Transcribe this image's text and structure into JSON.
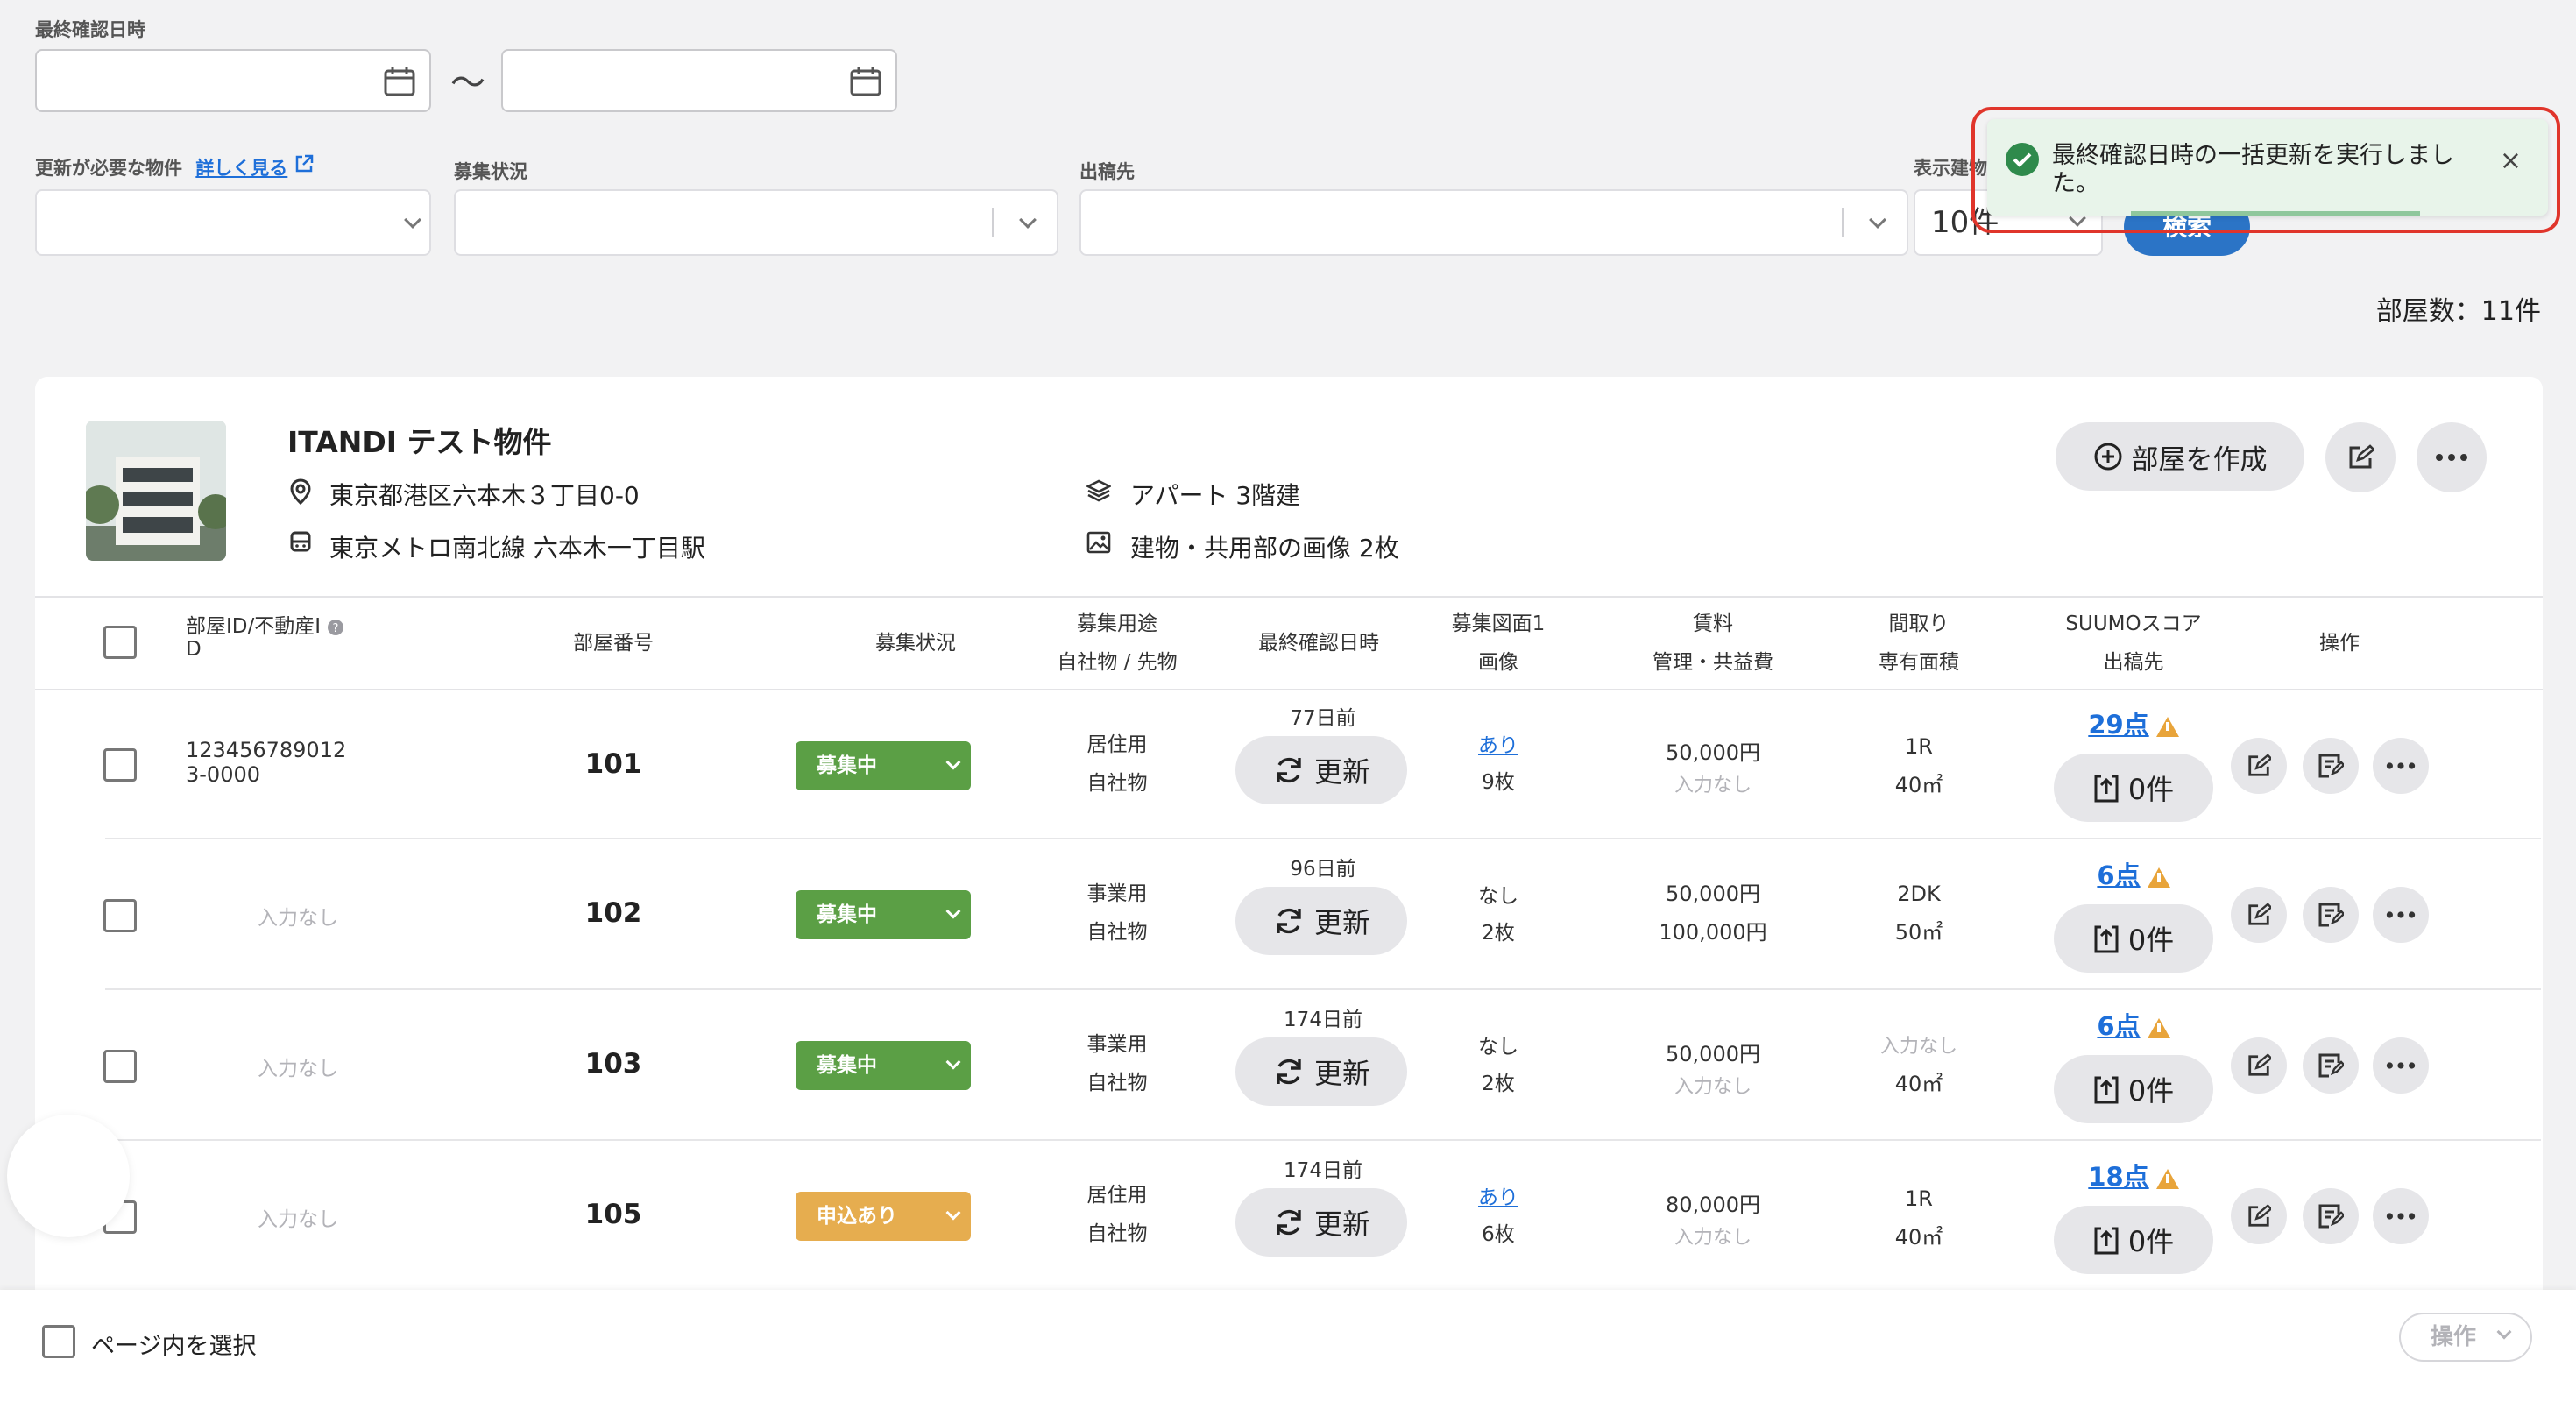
{
  "filters": {
    "last_confirmed_label": "最終確認日時",
    "range_sep": "〜",
    "needs_update_label": "更新が必要な物件",
    "details_link": "詳しく見る",
    "recruit_label": "募集状況",
    "publish_label": "出稿先",
    "display_label": "表示建物",
    "display_value": "10件",
    "search_button": "検索"
  },
  "room_count": "部屋数：11件",
  "toast": {
    "message": "最終確認日時の一括更新を実行しました。",
    "close": "×",
    "accent": "#2f8a4c"
  },
  "property": {
    "name": "ITANDI テスト物件",
    "address": "東京都港区六本木３丁目0-0",
    "station": "東京メトロ南北線 六本木一丁目駅",
    "type": "アパート 3階建",
    "images": "建物・共用部の画像 2枚",
    "create_room_button": "部屋を作成"
  },
  "table": {
    "headers": {
      "room_id_1": "部屋ID/不動産I",
      "room_id_2": "D",
      "room_no": "部屋番号",
      "status": "募集状況",
      "use_1": "募集用途",
      "use_2": "自社物 / 先物",
      "last_confirmed": "最終確認日時",
      "plan_1": "募集図面1",
      "plan_2": "画像",
      "rent_1": "賃料",
      "rent_2": "管理・共益費",
      "layout_1": "間取り",
      "layout_2": "専有面積",
      "suumo_1": "SUUMOスコア",
      "suumo_2": "出稿先",
      "ops": "操作"
    },
    "update_label": "更新",
    "rows": [
      {
        "id_1": "123456789012",
        "id_2": "3-0000",
        "room_no": "101",
        "status": "募集中",
        "use": "居住用",
        "owner": "自社物",
        "days": "77日前",
        "plan": "あり",
        "plan_count": "9枚",
        "rent": "50,000円",
        "fee": "入力なし",
        "layout": "1R",
        "area": "40㎡",
        "score": "29点",
        "publish": "0件"
      },
      {
        "id_1": "入力なし",
        "id_2": "",
        "room_no": "102",
        "status": "募集中",
        "use": "事業用",
        "owner": "自社物",
        "days": "96日前",
        "plan": "なし",
        "plan_count": "2枚",
        "rent": "50,000円",
        "fee": "100,000円",
        "layout": "2DK",
        "area": "50㎡",
        "score": "6点",
        "publish": "0件"
      },
      {
        "id_1": "入力なし",
        "id_2": "",
        "room_no": "103",
        "status": "募集中",
        "use": "事業用",
        "owner": "自社物",
        "days": "174日前",
        "plan": "なし",
        "plan_count": "2枚",
        "rent": "50,000円",
        "fee": "入力なし",
        "layout": "入力なし",
        "area": "40㎡",
        "score": "6点",
        "publish": "0件"
      },
      {
        "id_1": "入力なし",
        "id_2": "",
        "room_no": "105",
        "status": "申込あり",
        "use": "居住用",
        "owner": "自社物",
        "days": "174日前",
        "plan": "あり",
        "plan_count": "6枚",
        "rent": "80,000円",
        "fee": "入力なし",
        "layout": "1R",
        "area": "40㎡",
        "score": "18点",
        "publish": "0件"
      }
    ]
  },
  "footer": {
    "select_page": "ページ内を選択",
    "ops_button": "操作"
  },
  "colors": {
    "status_recruiting": "#5b9f45",
    "status_applied": "#e6ad4f",
    "link": "#1e6fd9",
    "highlight": "#e0352b"
  }
}
